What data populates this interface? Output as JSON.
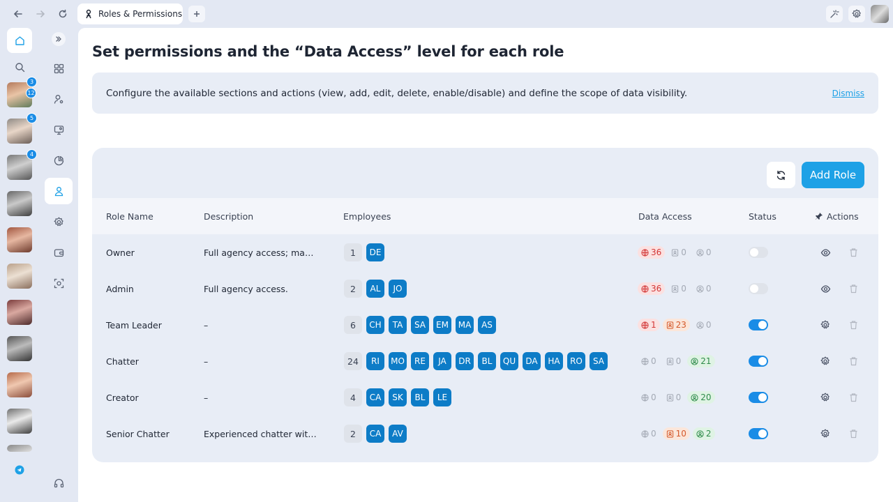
{
  "browser": {
    "tab_title": "Roles & Permissions"
  },
  "rail": {
    "avatars": [
      {
        "badges": [
          "3",
          "12"
        ]
      },
      {
        "badges": [
          "5"
        ]
      },
      {
        "badges": [
          "4"
        ]
      },
      {
        "badges": []
      },
      {
        "badges": []
      },
      {
        "badges": []
      },
      {
        "badges": []
      },
      {
        "badges": []
      },
      {
        "badges": []
      },
      {
        "badges": []
      }
    ]
  },
  "page": {
    "title": "Set permissions and the “Data Access” level for each role",
    "info_text": "Configure the available sections and actions (view, add, edit, delete, enable/disable) and define the scope of data visibility.",
    "dismiss_label": "Dismiss",
    "add_role_label": "Add Role"
  },
  "table": {
    "headers": {
      "role_name": "Role Name",
      "description": "Description",
      "employees": "Employees",
      "data_access": "Data Access",
      "status": "Status",
      "actions": "Actions"
    },
    "rows": [
      {
        "name": "Owner",
        "description": "Full agency access; manag...",
        "count": "1",
        "chips": [
          "DE"
        ],
        "access": {
          "global": "36",
          "team": "0",
          "personal": "0"
        },
        "access_style": [
          "red",
          "grey",
          "grey"
        ],
        "status": "off",
        "action": "view"
      },
      {
        "name": "Admin",
        "description": "Full agency access.",
        "count": "2",
        "chips": [
          "AL",
          "JO"
        ],
        "access": {
          "global": "36",
          "team": "0",
          "personal": "0"
        },
        "access_style": [
          "red",
          "grey",
          "grey"
        ],
        "status": "off",
        "action": "view"
      },
      {
        "name": "Team Leader",
        "description": "–",
        "count": "6",
        "chips": [
          "CH",
          "TA",
          "SA",
          "EM",
          "MA",
          "AS"
        ],
        "access": {
          "global": "1",
          "team": "23",
          "personal": "0"
        },
        "access_style": [
          "red",
          "orange",
          "grey"
        ],
        "status": "on",
        "action": "settings"
      },
      {
        "name": "Chatter",
        "description": "–",
        "count": "24",
        "chips": [
          "RI",
          "MO",
          "RE",
          "JA",
          "DR",
          "BL",
          "QU",
          "DA",
          "HA",
          "RO",
          "SA"
        ],
        "access": {
          "global": "0",
          "team": "0",
          "personal": "21"
        },
        "access_style": [
          "grey",
          "grey",
          "green"
        ],
        "status": "on",
        "action": "settings"
      },
      {
        "name": "Creator",
        "description": "–",
        "count": "4",
        "chips": [
          "CA",
          "SK",
          "BL",
          "LE"
        ],
        "access": {
          "global": "0",
          "team": "0",
          "personal": "20"
        },
        "access_style": [
          "grey",
          "grey",
          "green"
        ],
        "status": "on",
        "action": "settings"
      },
      {
        "name": "Senior Chatter",
        "description": "Experienced chatter with s...",
        "count": "2",
        "chips": [
          "CA",
          "AV"
        ],
        "access": {
          "global": "0",
          "team": "10",
          "personal": "2"
        },
        "access_style": [
          "grey",
          "orange",
          "green"
        ],
        "status": "on",
        "action": "settings"
      }
    ]
  },
  "colors": {
    "accent": "#1ea1e6",
    "chip": "#0d7cc7",
    "toggle_on": "#1a8ce6",
    "global_access": "#d33636",
    "team_access": "#d4592b",
    "personal_access": "#2e8b4a"
  },
  "icons": {
    "global": "globe-icon",
    "team": "id-card-icon",
    "personal": "user-circle-icon",
    "view": "eye-icon",
    "settings": "gear-icon",
    "delete": "trash-icon"
  }
}
